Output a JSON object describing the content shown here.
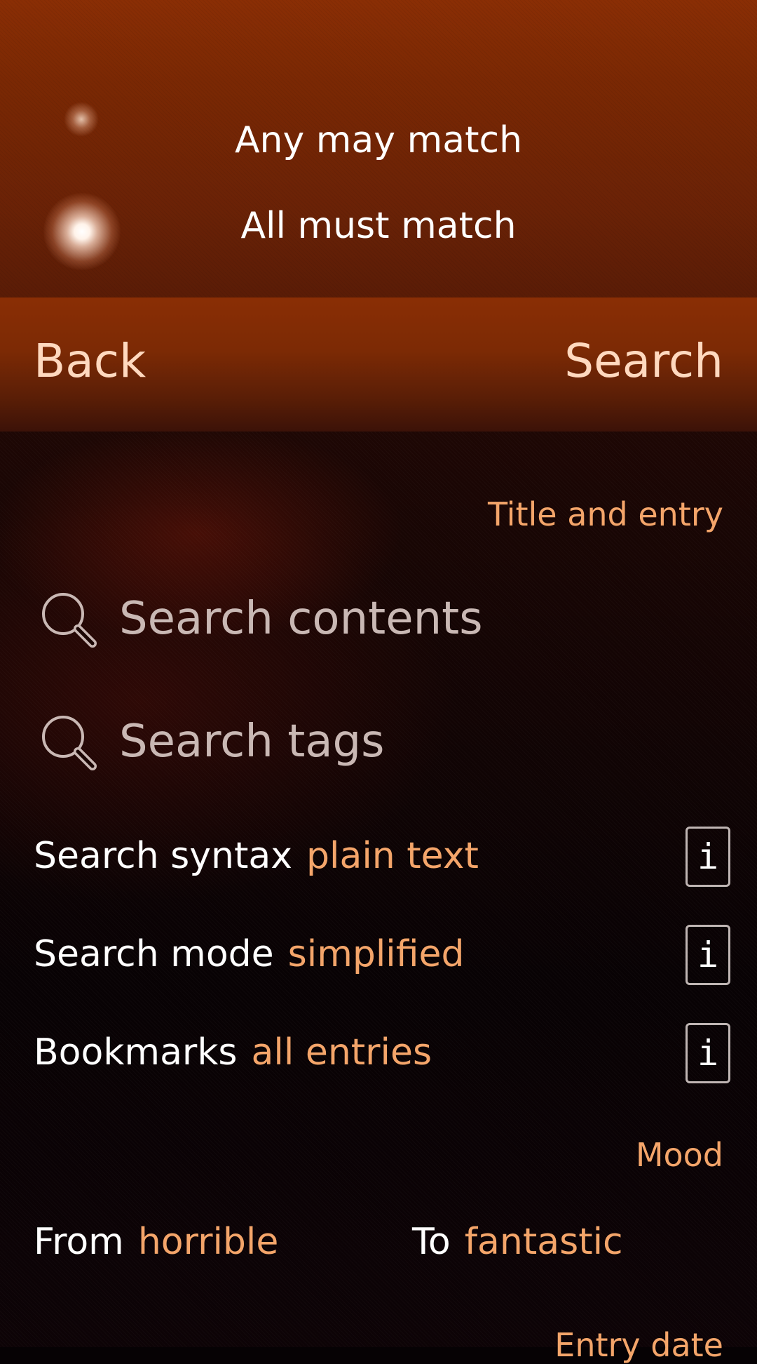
{
  "pulley_menu": {
    "items": [
      {
        "label": "Any may match",
        "selected": false
      },
      {
        "label": "All must match",
        "selected": true
      }
    ]
  },
  "header": {
    "back_label": "Back",
    "accept_label": "Search"
  },
  "sections": {
    "title_and_entry": "Title and entry",
    "mood": "Mood",
    "entry_date": "Entry date"
  },
  "search": {
    "contents_placeholder": "Search contents",
    "contents_value": "",
    "tags_placeholder": "Search tags",
    "tags_value": ""
  },
  "combos": {
    "syntax": {
      "label": "Search syntax",
      "value": "plain text"
    },
    "mode": {
      "label": "Search mode",
      "value": "simplified"
    },
    "bookmarks": {
      "label": "Bookmarks",
      "value": "all entries"
    }
  },
  "info_glyph": "i",
  "mood": {
    "from_label": "From",
    "from_value": "horrible",
    "to_label": "To",
    "to_value": "fantastic"
  },
  "colors": {
    "accent": "#f4a56a",
    "header_bg": "#8a2e05",
    "placeholder": "#c9b8b4"
  }
}
